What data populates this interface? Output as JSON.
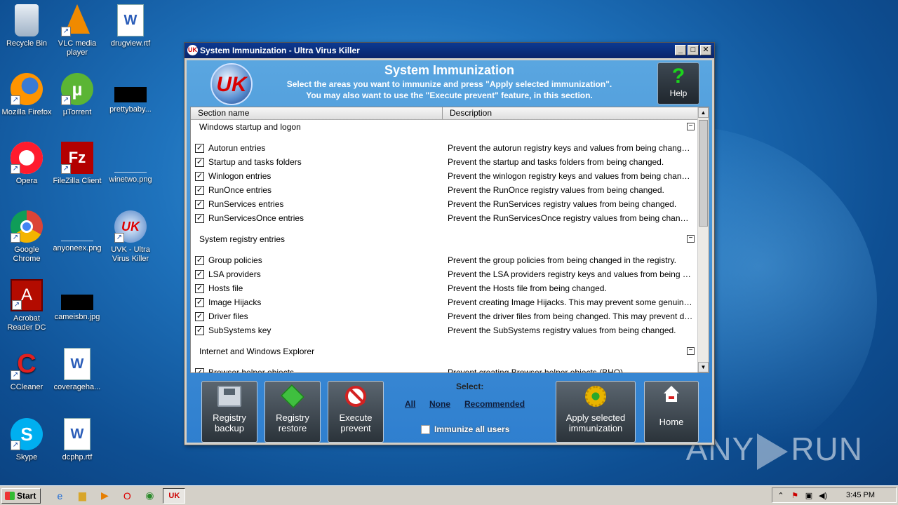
{
  "desktop": {
    "icons": [
      {
        "label": "Recycle Bin",
        "glyph": "🗑"
      },
      {
        "label": "VLC media player",
        "glyph": "▲"
      },
      {
        "label": "drugview.rtf",
        "glyph": "W"
      },
      {
        "label": "Mozilla Firefox",
        "glyph": "●"
      },
      {
        "label": "µTorrent",
        "glyph": "µ"
      },
      {
        "label": "prettybaby...",
        "glyph": ""
      },
      {
        "label": "Opera",
        "glyph": "O"
      },
      {
        "label": "FileZilla Client",
        "glyph": "Fz"
      },
      {
        "label": "winetwo.png",
        "glyph": ""
      },
      {
        "label": "Google Chrome",
        "glyph": "◉"
      },
      {
        "label": "anyoneex.png",
        "glyph": ""
      },
      {
        "label": "UVK - Ultra Virus Killer",
        "glyph": "UK"
      },
      {
        "label": "Acrobat Reader DC",
        "glyph": "A"
      },
      {
        "label": "cameisbn.jpg",
        "glyph": ""
      },
      {
        "label": "CCleaner",
        "glyph": "C"
      },
      {
        "label": "coverageha...",
        "glyph": "W"
      },
      {
        "label": "Skype",
        "glyph": "S"
      },
      {
        "label": "dcphp.rtf",
        "glyph": "W"
      }
    ],
    "watermark": "ANY RUN"
  },
  "window": {
    "title": "System Immunization - Ultra Virus Killer",
    "buttons": {
      "minimize": "_",
      "maximize": "□",
      "close": "✕"
    },
    "logo": "UK",
    "header": {
      "title": "System Immunization",
      "line1": "Select the areas you want to immunize and press \"Apply selected immunization\".",
      "line2": "You may also want to use the \"Execute prevent\" feature, in this section."
    },
    "help": {
      "glyph": "?",
      "label": "Help"
    },
    "list": {
      "col_section": "Section name",
      "col_description": "Description",
      "sections": [
        {
          "title": "Windows startup and logon",
          "items": [
            {
              "name": "Autorun entries",
              "desc": "Prevent the autorun registry keys and values from being changed.",
              "checked": true
            },
            {
              "name": "Startup and tasks folders",
              "desc": "Prevent the startup and tasks folders from being changed.",
              "checked": true
            },
            {
              "name": "Winlogon entries",
              "desc": "Prevent the winlogon registry keys and values from being changed.",
              "checked": true
            },
            {
              "name": "RunOnce entries",
              "desc": "Prevent the RunOnce registry values from being changed.",
              "checked": true
            },
            {
              "name": "RunServices entries",
              "desc": "Prevent the RunServices registry values from being changed.",
              "checked": true
            },
            {
              "name": "RunServicesOnce entries",
              "desc": "Prevent the RunServicesOnce registry values from being changed.",
              "checked": true
            }
          ]
        },
        {
          "title": "System registry entries",
          "items": [
            {
              "name": "Group policies",
              "desc": "Prevent the group policies from being changed in the registry.",
              "checked": true
            },
            {
              "name": "LSA providers",
              "desc": "Prevent the LSA providers registry keys and values from being changed.",
              "checked": true
            },
            {
              "name": "Hosts file",
              "desc": "Prevent the Hosts file from being changed.",
              "checked": true
            },
            {
              "name": "Image Hijacks",
              "desc": "Prevent creating Image Hijacks. This may prevent some genuine software from running.",
              "checked": true
            },
            {
              "name": "Driver files",
              "desc": "Prevent the driver files from being changed. This may prevent driver updates.",
              "checked": true
            },
            {
              "name": "SubSystems key",
              "desc": "Prevent the SubSystems registry values from being changed.",
              "checked": true
            }
          ]
        },
        {
          "title": "Internet and Windows Explorer",
          "items": [
            {
              "name": "Browser helper objects",
              "desc": "Prevent creating Browser helper objects (BHO).",
              "checked": true
            }
          ]
        }
      ]
    },
    "toolbar": {
      "registry_backup": "Registry backup",
      "registry_restore": "Registry restore",
      "execute_prevent": "Execute prevent",
      "select_label": "Select:",
      "select_all": "All",
      "select_none": "None",
      "select_recommended": "Recommended",
      "immunize_all_users": "Immunize all users",
      "apply": "Apply selected immunization",
      "home": "Home"
    }
  },
  "taskbar": {
    "start": "Start",
    "clock": "3:45 PM"
  }
}
